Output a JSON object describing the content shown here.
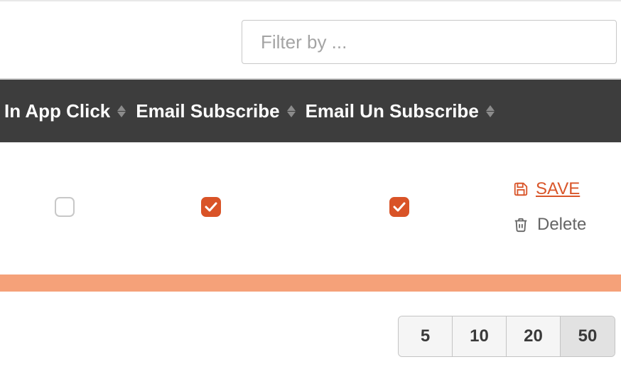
{
  "filter": {
    "placeholder": "Filter by ..."
  },
  "columns": [
    {
      "label": "In App Click"
    },
    {
      "label": "Email Subscribe"
    },
    {
      "label": "Email Un Subscribe"
    }
  ],
  "row": {
    "in_app_click": false,
    "email_subscribe": true,
    "email_unsubscribe": true
  },
  "actions": {
    "save_label": "SAVE",
    "delete_label": "Delete"
  },
  "colors": {
    "accent": "#d9562a",
    "header_bg": "#3d3d3d",
    "bar": "#f5a179"
  },
  "pager": {
    "options": [
      "5",
      "10",
      "20",
      "50"
    ],
    "active": "50"
  }
}
